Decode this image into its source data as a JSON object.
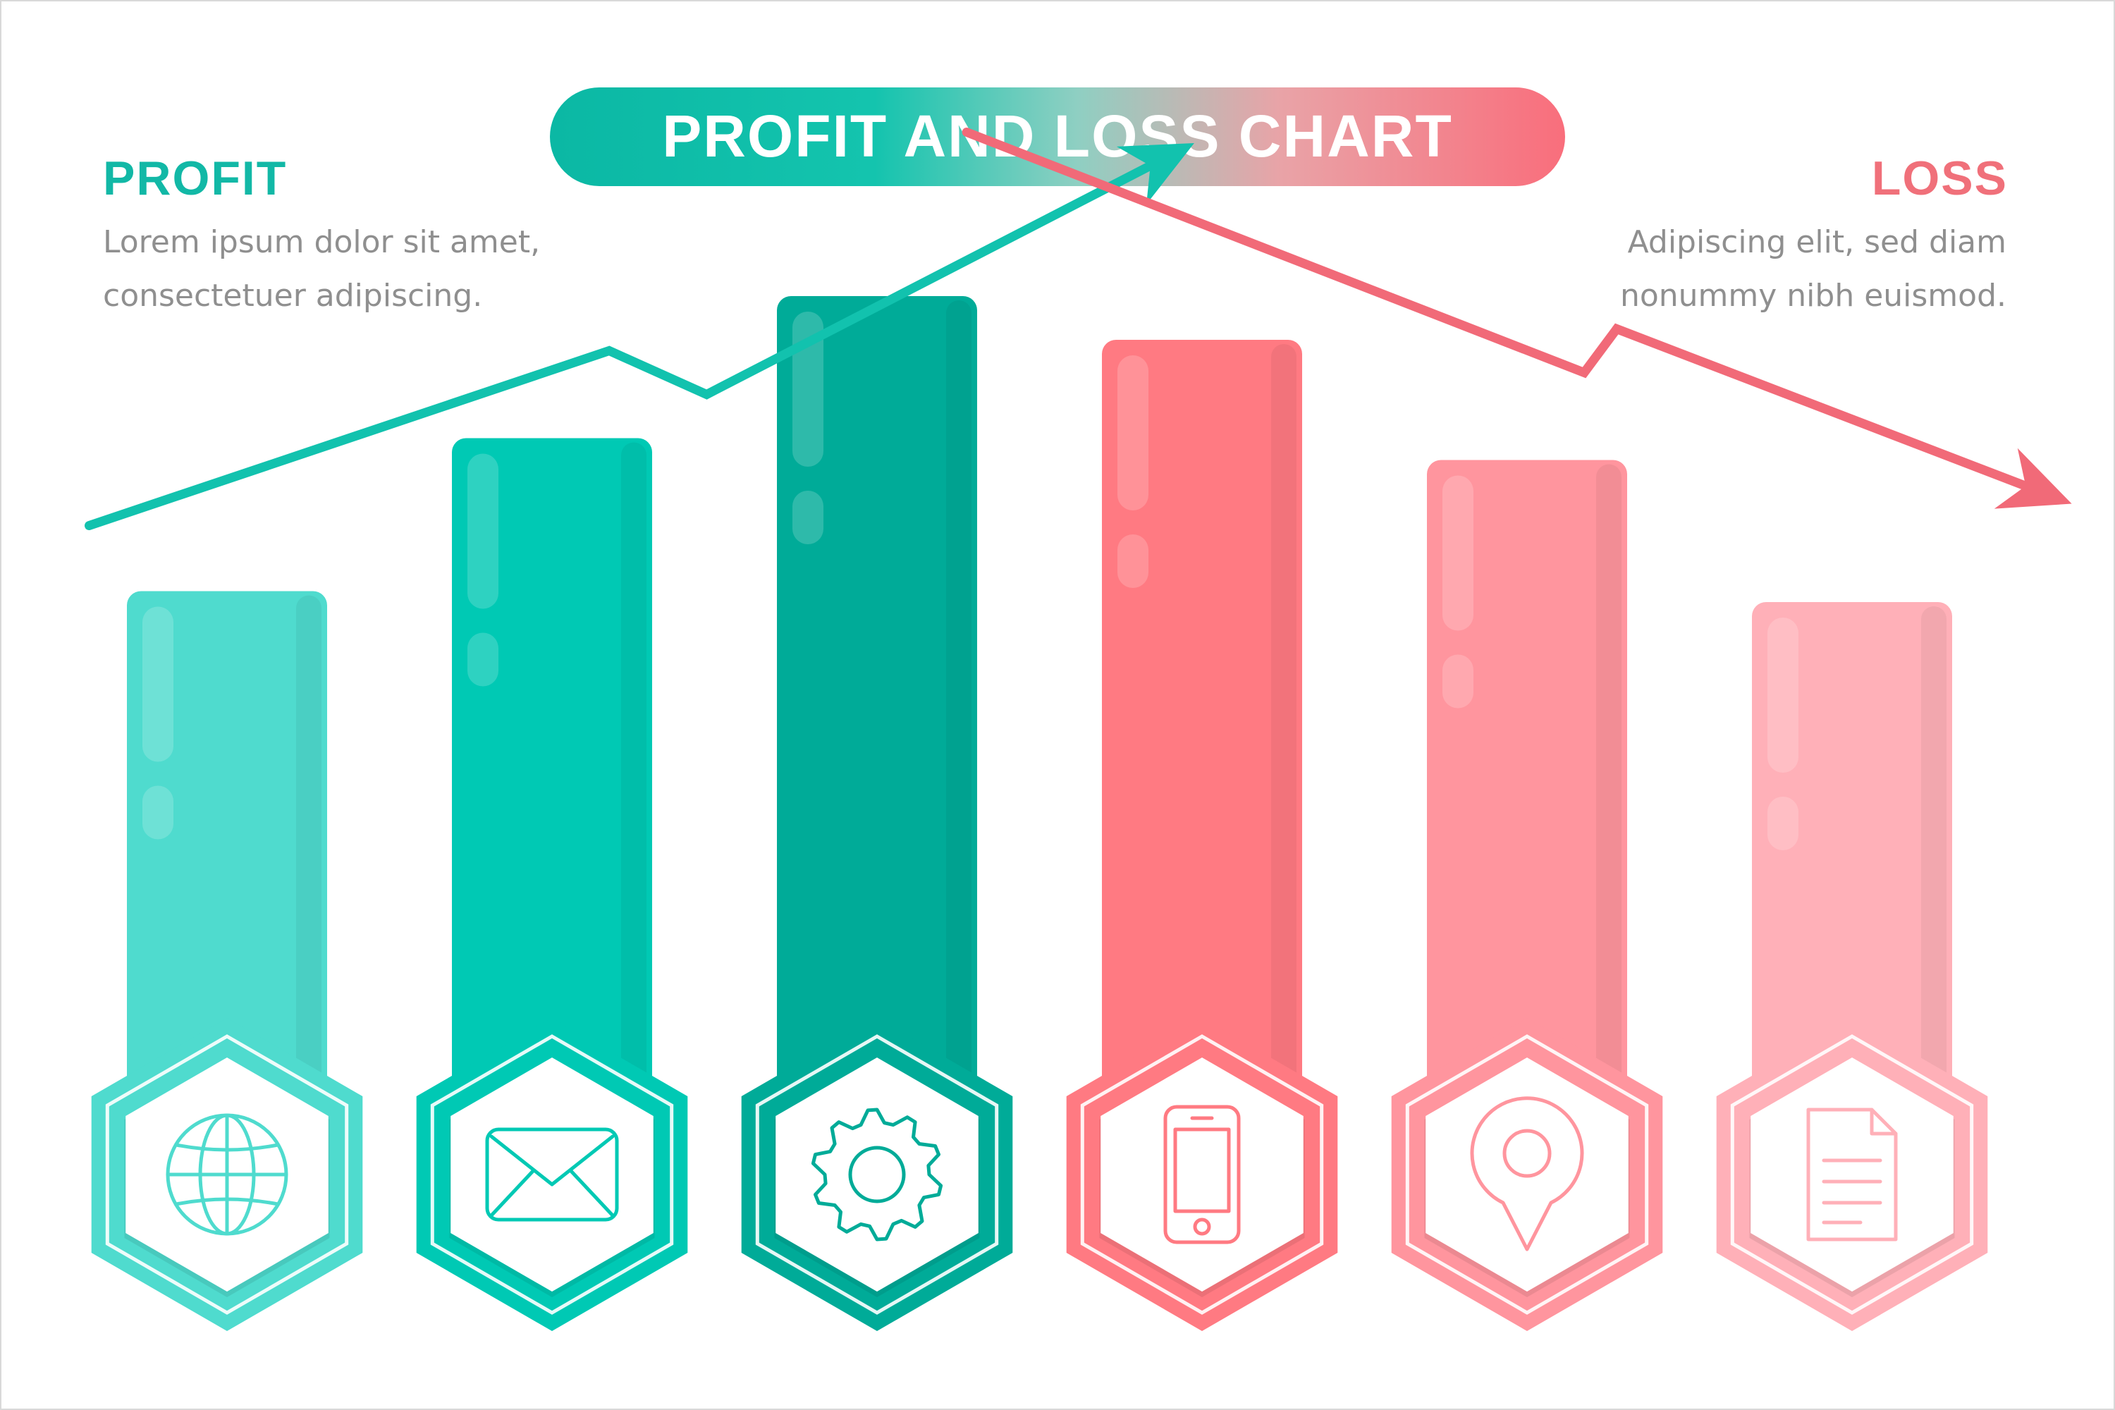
{
  "title": "PROFIT AND LOSS CHART",
  "profit": {
    "heading": "PROFIT",
    "lines": [
      "Lorem ipsum dolor sit amet,",
      "consectetuer adipiscing."
    ],
    "color": "#12B8A6"
  },
  "loss": {
    "heading": "LOSS",
    "lines": [
      "Adipiscing elit, sed diam",
      "nonummy nibh euismod."
    ],
    "color": "#F0707A"
  },
  "colors": {
    "teal_light": "#4FDBCE",
    "teal": "#00C9B4",
    "teal_dark": "#00AB98",
    "coral_dark": "#FF7A82",
    "coral": "#FF959E",
    "coral_light": "#FFB0B8",
    "trend_up": "#12C2AE",
    "trend_down": "#F16A78"
  },
  "chart_data": {
    "type": "bar",
    "categories": [
      "globe-icon",
      "envelope-icon",
      "gear-icon",
      "smartphone-icon",
      "location-pin-icon",
      "document-icon"
    ],
    "values": [
      53,
      67,
      80,
      76,
      65,
      52
    ],
    "groups": [
      "profit",
      "profit",
      "profit",
      "loss",
      "loss",
      "loss"
    ],
    "trend_up": [
      [
        0,
        59
      ],
      [
        1.6,
        75
      ],
      [
        1.9,
        71
      ],
      [
        3.4,
        94
      ]
    ],
    "trend_down": [
      [
        2.7,
        95
      ],
      [
        4.6,
        73
      ],
      [
        4.7,
        77
      ],
      [
        6.1,
        61
      ]
    ],
    "grid": false,
    "legend": "none"
  }
}
